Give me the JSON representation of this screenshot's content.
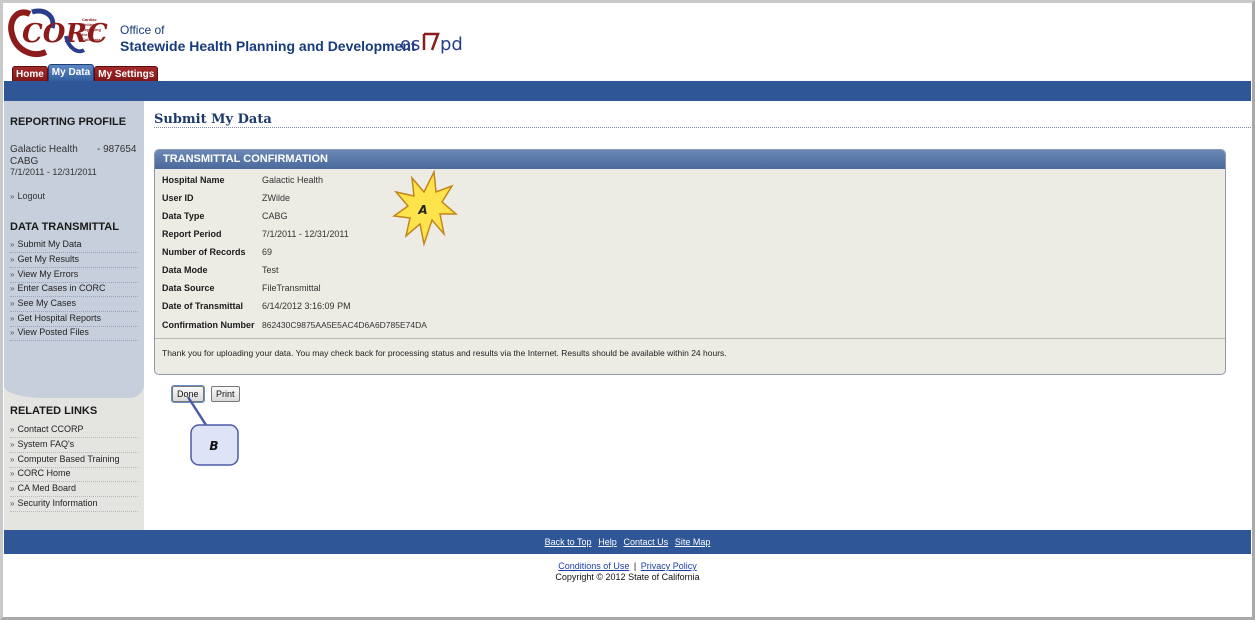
{
  "header": {
    "logo_text": "CORC",
    "logo_subtext": "Cardiac Online Reporting for California",
    "agency_line1": "Office of",
    "agency_line2": "Statewide Health Planning and Development",
    "oshpd_logo": "oshpd"
  },
  "tabs": [
    {
      "label": "Home"
    },
    {
      "label": "My Data"
    },
    {
      "label": "My Settings"
    }
  ],
  "sidebar": {
    "profile_heading": "REPORTING PROFILE",
    "hospital": "Galactic Health",
    "hospital_id": "- 987654",
    "data_type": "CABG",
    "period": "7/1/2011 - 12/31/2011",
    "logout": "Logout",
    "transmittal_heading": "DATA TRANSMITTAL",
    "transmittal_links": [
      {
        "label": "Submit My Data"
      },
      {
        "label": "Get My Results"
      },
      {
        "label": "View My Errors"
      },
      {
        "label": "Enter Cases in CORC"
      },
      {
        "label": "See My Cases"
      },
      {
        "label": "Get Hospital Reports"
      },
      {
        "label": "View Posted Files"
      }
    ],
    "related_heading": "RELATED LINKS",
    "related_links": [
      {
        "label": "Contact CCORP"
      },
      {
        "label": "System FAQ's"
      },
      {
        "label": "Computer Based Training"
      },
      {
        "label": "CORC Home"
      },
      {
        "label": "CA Med Board"
      },
      {
        "label": "Security Information"
      }
    ]
  },
  "main": {
    "title": "Submit My Data",
    "panel_title": "TRANSMITTAL CONFIRMATION",
    "fields": [
      {
        "label": "Hospital Name",
        "value": "Galactic Health"
      },
      {
        "label": "User ID",
        "value": "ZWilde"
      },
      {
        "label": "Data Type",
        "value": "CABG"
      },
      {
        "label": "Report Period",
        "value": "7/1/2011 - 12/31/2011"
      },
      {
        "label": "Number of Records",
        "value": "69"
      },
      {
        "label": "Data Mode",
        "value": "Test"
      },
      {
        "label": "Data Source",
        "value": "FileTransmittal"
      },
      {
        "label": "Date of Transmittal",
        "value": "6/14/2012 3:16:09 PM"
      },
      {
        "label": "Confirmation Number",
        "value": "862430C9875AA5E5AC4D6A6D785E74DA"
      }
    ],
    "message": "Thank you for uploading your data. You may check back for processing status and results via the Internet. Results should be available within 24 hours.",
    "done_button": "Done",
    "print_button": "Print"
  },
  "annotations": {
    "star_label": "A",
    "callout_label": "B",
    "star_color": "#ffe34d",
    "callout_color": "#dfe3f7"
  },
  "footer": {
    "links": [
      {
        "label": "Back to Top"
      },
      {
        "label": "Help"
      },
      {
        "label": "Contact Us"
      },
      {
        "label": "Site Map"
      }
    ],
    "conditions": "Conditions of Use",
    "separator": "|",
    "privacy": "Privacy Policy",
    "copyright": "Copyright © 2012 State of California"
  }
}
